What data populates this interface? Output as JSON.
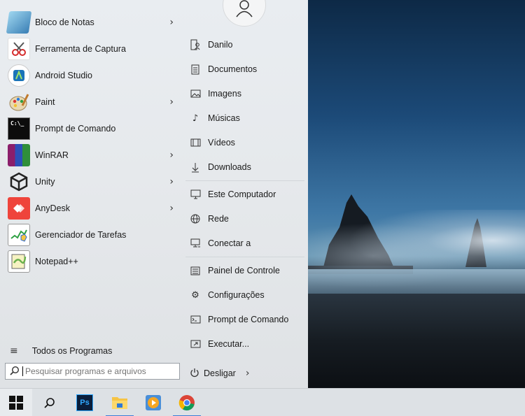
{
  "colors": {
    "menu_bg": "#e6e9ec",
    "taskbar_bg": "#dde1e5",
    "accent": "#3c7ed6"
  },
  "programs": [
    {
      "label": "Bloco de Notas",
      "icon": "notepad-icon",
      "has_submenu": true
    },
    {
      "label": "Ferramenta de Captura",
      "icon": "snipping-tool-icon",
      "has_submenu": false
    },
    {
      "label": "Android Studio",
      "icon": "android-studio-icon",
      "has_submenu": false
    },
    {
      "label": "Paint",
      "icon": "paint-palette-icon",
      "has_submenu": true
    },
    {
      "label": "Prompt de Comando",
      "icon": "cmd-icon",
      "has_submenu": false
    },
    {
      "label": "WinRAR",
      "icon": "winrar-icon",
      "has_submenu": true
    },
    {
      "label": "Unity",
      "icon": "unity-icon",
      "has_submenu": true
    },
    {
      "label": "AnyDesk",
      "icon": "anydesk-icon",
      "has_submenu": true
    },
    {
      "label": "Gerenciador de Tarefas",
      "icon": "task-manager-icon",
      "has_submenu": false
    },
    {
      "label": "Notepad++",
      "icon": "notepad-plus-plus-icon",
      "has_submenu": false
    }
  ],
  "cmd_icon_text": "C:\\_",
  "all_programs_label": "Todos os Programas",
  "search": {
    "placeholder": "Pesquisar programas e arquivos"
  },
  "right_items": [
    {
      "label": "Danilo",
      "icon": "user-folder-icon"
    },
    {
      "label": "Documentos",
      "icon": "document-icon"
    },
    {
      "label": "Imagens",
      "icon": "image-icon"
    },
    {
      "label": "Músicas",
      "icon": "music-note-icon"
    },
    {
      "label": "Vídeos",
      "icon": "video-icon"
    },
    {
      "label": "Downloads",
      "icon": "download-icon"
    },
    {
      "label": "Este Computador",
      "icon": "computer-icon"
    },
    {
      "label": "Rede",
      "icon": "network-icon"
    },
    {
      "label": "Conectar a",
      "icon": "connect-icon"
    },
    {
      "label": "Painel de Controle",
      "icon": "control-panel-icon"
    },
    {
      "label": "Configurações",
      "icon": "gear-icon"
    },
    {
      "label": "Prompt de Comando",
      "icon": "cmd-icon"
    },
    {
      "label": "Executar...",
      "icon": "run-icon"
    }
  ],
  "shutdown_label": "Desligar",
  "taskbar": {
    "buttons": [
      "windows-start-icon",
      "search-icon",
      "photoshop-icon",
      "file-explorer-icon",
      "media-player-icon",
      "chrome-icon"
    ],
    "photoshop_text": "Ps"
  }
}
